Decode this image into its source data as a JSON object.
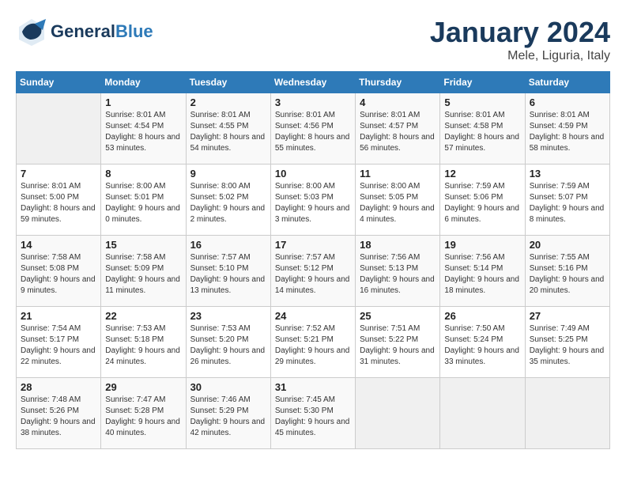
{
  "logo": {
    "general": "General",
    "blue": "Blue"
  },
  "header": {
    "month": "January 2024",
    "location": "Mele, Liguria, Italy"
  },
  "weekdays": [
    "Sunday",
    "Monday",
    "Tuesday",
    "Wednesday",
    "Thursday",
    "Friday",
    "Saturday"
  ],
  "weeks": [
    [
      {
        "day": null
      },
      {
        "day": 1,
        "sunrise": "Sunrise: 8:01 AM",
        "sunset": "Sunset: 4:54 PM",
        "daylight": "Daylight: 8 hours and 53 minutes."
      },
      {
        "day": 2,
        "sunrise": "Sunrise: 8:01 AM",
        "sunset": "Sunset: 4:55 PM",
        "daylight": "Daylight: 8 hours and 54 minutes."
      },
      {
        "day": 3,
        "sunrise": "Sunrise: 8:01 AM",
        "sunset": "Sunset: 4:56 PM",
        "daylight": "Daylight: 8 hours and 55 minutes."
      },
      {
        "day": 4,
        "sunrise": "Sunrise: 8:01 AM",
        "sunset": "Sunset: 4:57 PM",
        "daylight": "Daylight: 8 hours and 56 minutes."
      },
      {
        "day": 5,
        "sunrise": "Sunrise: 8:01 AM",
        "sunset": "Sunset: 4:58 PM",
        "daylight": "Daylight: 8 hours and 57 minutes."
      },
      {
        "day": 6,
        "sunrise": "Sunrise: 8:01 AM",
        "sunset": "Sunset: 4:59 PM",
        "daylight": "Daylight: 8 hours and 58 minutes."
      }
    ],
    [
      {
        "day": 7,
        "sunrise": "Sunrise: 8:01 AM",
        "sunset": "Sunset: 5:00 PM",
        "daylight": "Daylight: 8 hours and 59 minutes."
      },
      {
        "day": 8,
        "sunrise": "Sunrise: 8:00 AM",
        "sunset": "Sunset: 5:01 PM",
        "daylight": "Daylight: 9 hours and 0 minutes."
      },
      {
        "day": 9,
        "sunrise": "Sunrise: 8:00 AM",
        "sunset": "Sunset: 5:02 PM",
        "daylight": "Daylight: 9 hours and 2 minutes."
      },
      {
        "day": 10,
        "sunrise": "Sunrise: 8:00 AM",
        "sunset": "Sunset: 5:03 PM",
        "daylight": "Daylight: 9 hours and 3 minutes."
      },
      {
        "day": 11,
        "sunrise": "Sunrise: 8:00 AM",
        "sunset": "Sunset: 5:05 PM",
        "daylight": "Daylight: 9 hours and 4 minutes."
      },
      {
        "day": 12,
        "sunrise": "Sunrise: 7:59 AM",
        "sunset": "Sunset: 5:06 PM",
        "daylight": "Daylight: 9 hours and 6 minutes."
      },
      {
        "day": 13,
        "sunrise": "Sunrise: 7:59 AM",
        "sunset": "Sunset: 5:07 PM",
        "daylight": "Daylight: 9 hours and 8 minutes."
      }
    ],
    [
      {
        "day": 14,
        "sunrise": "Sunrise: 7:58 AM",
        "sunset": "Sunset: 5:08 PM",
        "daylight": "Daylight: 9 hours and 9 minutes."
      },
      {
        "day": 15,
        "sunrise": "Sunrise: 7:58 AM",
        "sunset": "Sunset: 5:09 PM",
        "daylight": "Daylight: 9 hours and 11 minutes."
      },
      {
        "day": 16,
        "sunrise": "Sunrise: 7:57 AM",
        "sunset": "Sunset: 5:10 PM",
        "daylight": "Daylight: 9 hours and 13 minutes."
      },
      {
        "day": 17,
        "sunrise": "Sunrise: 7:57 AM",
        "sunset": "Sunset: 5:12 PM",
        "daylight": "Daylight: 9 hours and 14 minutes."
      },
      {
        "day": 18,
        "sunrise": "Sunrise: 7:56 AM",
        "sunset": "Sunset: 5:13 PM",
        "daylight": "Daylight: 9 hours and 16 minutes."
      },
      {
        "day": 19,
        "sunrise": "Sunrise: 7:56 AM",
        "sunset": "Sunset: 5:14 PM",
        "daylight": "Daylight: 9 hours and 18 minutes."
      },
      {
        "day": 20,
        "sunrise": "Sunrise: 7:55 AM",
        "sunset": "Sunset: 5:16 PM",
        "daylight": "Daylight: 9 hours and 20 minutes."
      }
    ],
    [
      {
        "day": 21,
        "sunrise": "Sunrise: 7:54 AM",
        "sunset": "Sunset: 5:17 PM",
        "daylight": "Daylight: 9 hours and 22 minutes."
      },
      {
        "day": 22,
        "sunrise": "Sunrise: 7:53 AM",
        "sunset": "Sunset: 5:18 PM",
        "daylight": "Daylight: 9 hours and 24 minutes."
      },
      {
        "day": 23,
        "sunrise": "Sunrise: 7:53 AM",
        "sunset": "Sunset: 5:20 PM",
        "daylight": "Daylight: 9 hours and 26 minutes."
      },
      {
        "day": 24,
        "sunrise": "Sunrise: 7:52 AM",
        "sunset": "Sunset: 5:21 PM",
        "daylight": "Daylight: 9 hours and 29 minutes."
      },
      {
        "day": 25,
        "sunrise": "Sunrise: 7:51 AM",
        "sunset": "Sunset: 5:22 PM",
        "daylight": "Daylight: 9 hours and 31 minutes."
      },
      {
        "day": 26,
        "sunrise": "Sunrise: 7:50 AM",
        "sunset": "Sunset: 5:24 PM",
        "daylight": "Daylight: 9 hours and 33 minutes."
      },
      {
        "day": 27,
        "sunrise": "Sunrise: 7:49 AM",
        "sunset": "Sunset: 5:25 PM",
        "daylight": "Daylight: 9 hours and 35 minutes."
      }
    ],
    [
      {
        "day": 28,
        "sunrise": "Sunrise: 7:48 AM",
        "sunset": "Sunset: 5:26 PM",
        "daylight": "Daylight: 9 hours and 38 minutes."
      },
      {
        "day": 29,
        "sunrise": "Sunrise: 7:47 AM",
        "sunset": "Sunset: 5:28 PM",
        "daylight": "Daylight: 9 hours and 40 minutes."
      },
      {
        "day": 30,
        "sunrise": "Sunrise: 7:46 AM",
        "sunset": "Sunset: 5:29 PM",
        "daylight": "Daylight: 9 hours and 42 minutes."
      },
      {
        "day": 31,
        "sunrise": "Sunrise: 7:45 AM",
        "sunset": "Sunset: 5:30 PM",
        "daylight": "Daylight: 9 hours and 45 minutes."
      },
      {
        "day": null
      },
      {
        "day": null
      },
      {
        "day": null
      }
    ]
  ]
}
